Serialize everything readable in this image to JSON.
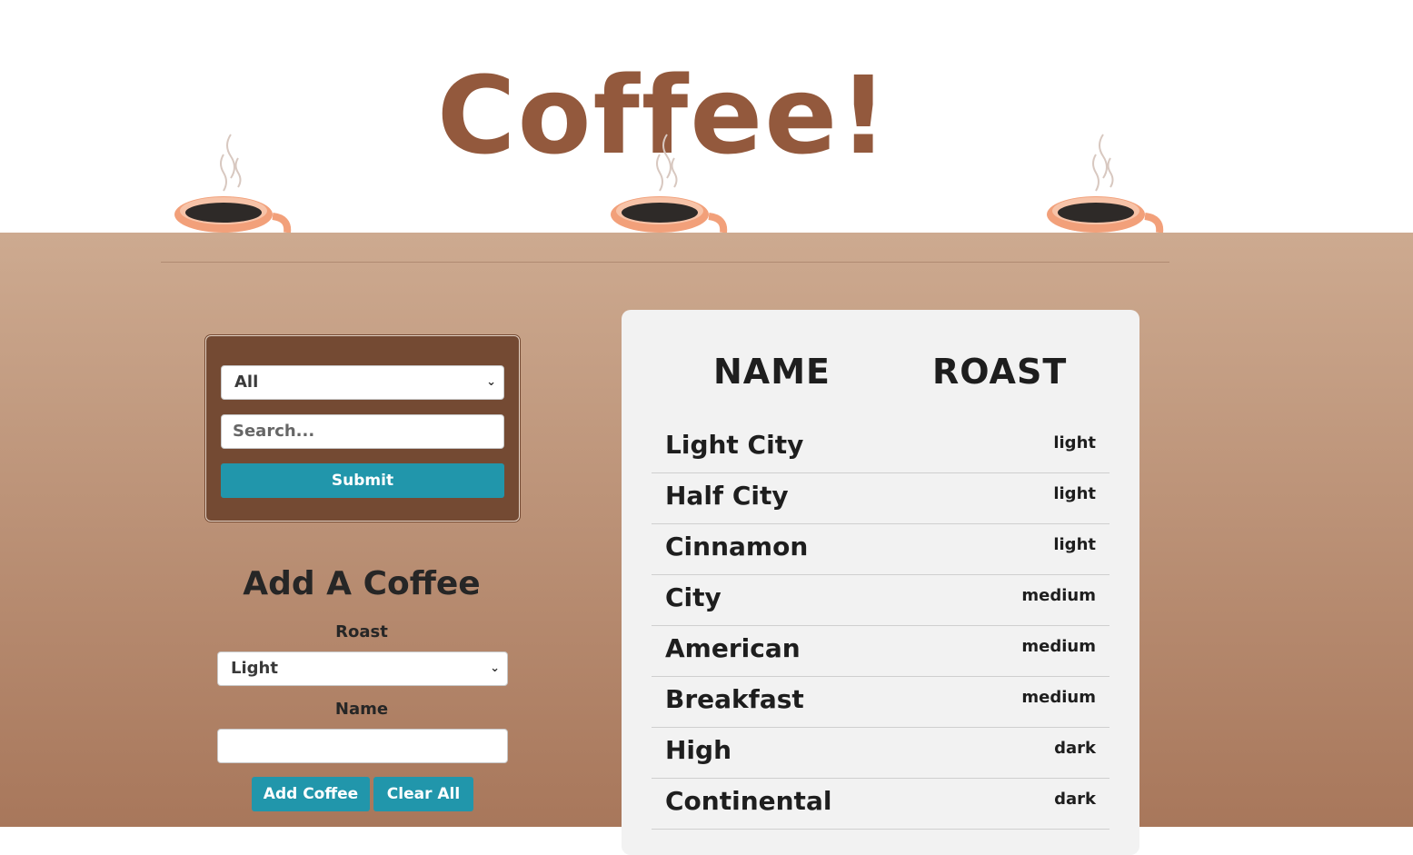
{
  "header": {
    "title": "Coffee!"
  },
  "filter": {
    "roast_value": "All",
    "search_placeholder": "Search...",
    "submit_label": "Submit"
  },
  "add_form": {
    "title": "Add A Coffee",
    "roast_label": "Roast",
    "roast_value": "Light",
    "name_label": "Name",
    "name_value": "",
    "add_label": "Add Coffee",
    "clear_label": "Clear All"
  },
  "table": {
    "headers": [
      "NAME",
      "ROAST"
    ],
    "rows": [
      {
        "name": "Light City",
        "roast": "light"
      },
      {
        "name": "Half City",
        "roast": "light"
      },
      {
        "name": "Cinnamon",
        "roast": "light"
      },
      {
        "name": "City",
        "roast": "medium"
      },
      {
        "name": "American",
        "roast": "medium"
      },
      {
        "name": "Breakfast",
        "roast": "medium"
      },
      {
        "name": "High",
        "roast": "dark"
      },
      {
        "name": "Continental",
        "roast": "dark"
      }
    ]
  },
  "colors": {
    "title": "#93593d",
    "filter_panel": "#744a33",
    "button": "#2196ab",
    "table_bg": "#f2f2f2"
  }
}
